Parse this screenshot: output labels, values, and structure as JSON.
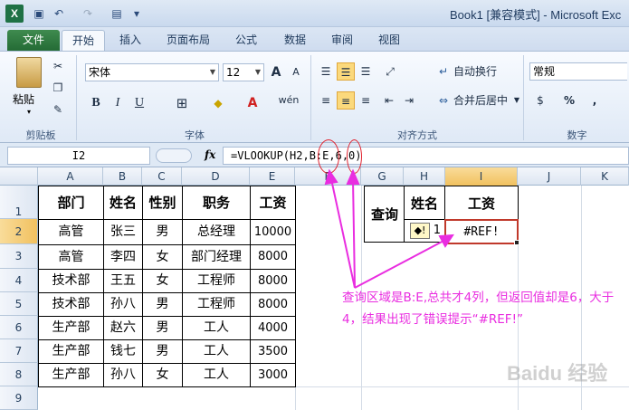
{
  "window": {
    "title": "Book1  [兼容模式] - Microsoft Exc",
    "app_icon": "X"
  },
  "tabs": [
    "文件",
    "开始",
    "插入",
    "页面布局",
    "公式",
    "数据",
    "审阅",
    "视图"
  ],
  "ribbon": {
    "paste_label": "粘贴",
    "clipboard_label": "剪贴板",
    "font_name": "宋体",
    "font_size": "12",
    "grow_font": "A",
    "shrink_font": "A",
    "bold": "B",
    "italic": "I",
    "underline": "U",
    "font_group_label": "字体",
    "wrap_text": "自动换行",
    "merge_center": "合并后居中",
    "alignment_label": "对齐方式",
    "number_format": "常规",
    "number_label": "数字",
    "percent": "%",
    "comma": ","
  },
  "formula_bar": {
    "name_box": "I2",
    "fx": "fx",
    "formula": "=VLOOKUP(H2,B:E,6,0)"
  },
  "columns": [
    "A",
    "B",
    "C",
    "D",
    "E",
    "F",
    "G",
    "H",
    "I",
    "J",
    "K"
  ],
  "rows": [
    "1",
    "2",
    "3",
    "4",
    "5",
    "6",
    "7",
    "8",
    "9"
  ],
  "table": {
    "headers": [
      "部门",
      "姓名",
      "性别",
      "职务",
      "工资"
    ],
    "rows": [
      [
        "高管",
        "张三",
        "男",
        "总经理",
        "10000"
      ],
      [
        "高管",
        "李四",
        "女",
        "部门经理",
        "8000"
      ],
      [
        "技术部",
        "王五",
        "女",
        "工程师",
        "8000"
      ],
      [
        "技术部",
        "孙八",
        "男",
        "工程师",
        "8000"
      ],
      [
        "生产部",
        "赵六",
        "男",
        "工人",
        "4000"
      ],
      [
        "生产部",
        "钱七",
        "男",
        "工人",
        "3500"
      ],
      [
        "生产部",
        "孙八",
        "女",
        "工人",
        "3000"
      ]
    ]
  },
  "query": {
    "label": "查询",
    "name_header": "姓名",
    "salary_header": "工资",
    "name_value": "1",
    "result": "#REF!"
  },
  "annotation": {
    "note": "查询区域是B:E,总共才4列，但返回值却是6，大于4，结果出现了错误提示“#REF!”",
    "arrow_color": "#e92de0"
  },
  "watermark": "Baidu 经验"
}
